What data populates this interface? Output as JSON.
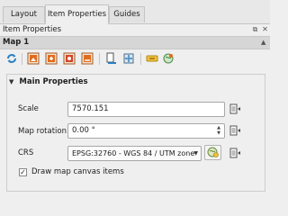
{
  "tabs": [
    {
      "label": "Layout"
    },
    {
      "label": "Item Properties"
    },
    {
      "label": "Guides"
    }
  ],
  "panel": {
    "title": "Item Properties"
  },
  "item": {
    "name": "Map 1"
  },
  "toolbar": {
    "icons": [
      "refresh-icon",
      "map-layers-icon",
      "set-extent-icon",
      "zoom-to-extent-icon",
      "view-extent-icon",
      "bookmark-icon",
      "label-settings-icon",
      "atlas-icon",
      "move-content-icon"
    ]
  },
  "main_properties": {
    "header": "Main Properties",
    "scale_label": "Scale",
    "scale_value": "7570.151",
    "rotation_label": "Map rotation",
    "rotation_value": "0.00 °",
    "crs_label": "CRS",
    "crs_value": "EPSG:32760 - WGS 84 / UTM zone",
    "draw_canvas_label": "Draw map canvas items",
    "draw_canvas_checked": true
  },
  "colors": {
    "accent": "#2c7fc1",
    "icon_orange": "#e06c1e",
    "icon_red": "#d2452b"
  }
}
